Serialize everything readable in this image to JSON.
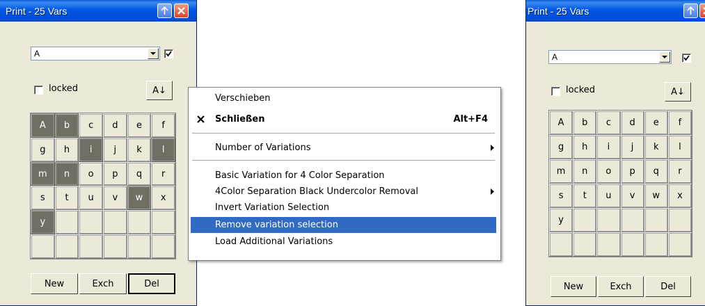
{
  "panels": [
    {
      "title": "Print - 25 Vars",
      "combo_value": "A",
      "locked_label": "locked",
      "sort_label": "A↓",
      "cells": [
        "A",
        "b",
        "c",
        "d",
        "e",
        "f",
        "g",
        "h",
        "i",
        "j",
        "k",
        "l",
        "m",
        "n",
        "o",
        "p",
        "q",
        "r",
        "s",
        "t",
        "u",
        "v",
        "w",
        "x",
        "y",
        "",
        "",
        "",
        "",
        "",
        "",
        "",
        "",
        "",
        "",
        ""
      ],
      "selected": [
        "A",
        "b",
        "i",
        "l",
        "m",
        "n",
        "w",
        "y"
      ],
      "buttons": {
        "new": "New",
        "exch": "Exch",
        "del": "Del"
      }
    },
    {
      "title": "Print - 25 Vars",
      "combo_value": "A",
      "locked_label": "locked",
      "sort_label": "A↓",
      "cells": [
        "A",
        "b",
        "c",
        "d",
        "e",
        "f",
        "g",
        "h",
        "i",
        "j",
        "k",
        "l",
        "m",
        "n",
        "o",
        "p",
        "q",
        "r",
        "s",
        "t",
        "u",
        "v",
        "w",
        "x",
        "y",
        "",
        "",
        "",
        "",
        "",
        "",
        "",
        "",
        "",
        "",
        ""
      ],
      "selected": [],
      "buttons": {
        "new": "New",
        "exch": "Exch",
        "del": "Del"
      }
    }
  ],
  "menu": {
    "items": [
      {
        "label": "Verschieben"
      },
      {
        "label": "Schließen",
        "shortcut": "Alt+F4"
      },
      {
        "label": "Number of Variations"
      },
      {
        "label": "Basic Variation for 4 Color Separation"
      },
      {
        "label": "4Color Separation Black Undercolor Removal"
      },
      {
        "label": "Invert Variation Selection"
      },
      {
        "label": "Remove variation selection"
      },
      {
        "label": "Load Additional Variations"
      }
    ],
    "highlighted_index": 6
  },
  "colors": {
    "titlebar": "#0058e6",
    "window_bg": "#ece9d8",
    "selected_cell": "#716f64",
    "menu_highlight": "#316ac5"
  }
}
